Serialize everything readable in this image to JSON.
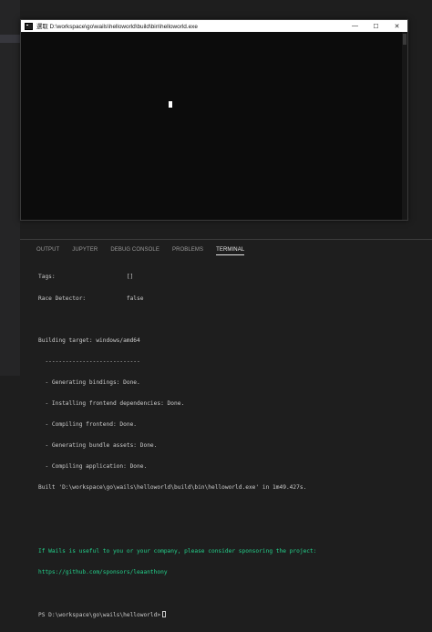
{
  "console": {
    "title": "選取 D:\\workspace\\go\\wails\\helloworld\\build\\bin\\helloworld.exe",
    "controls": {
      "minimize": "—",
      "maximize": "☐",
      "close": "✕"
    }
  },
  "panel": {
    "tabs": [
      {
        "label": "OUTPUT"
      },
      {
        "label": "JUPYTER"
      },
      {
        "label": "DEBUG CONSOLE"
      },
      {
        "label": "PROBLEMS"
      },
      {
        "label": "TERMINAL"
      }
    ],
    "active_tab": "TERMINAL"
  },
  "terminal": {
    "lines": [
      "Tags:                     []",
      "Race Detector:            false",
      "",
      "Building target: windows/amd64",
      "  ----------------------------",
      "  - Generating bindings: Done.",
      "  - Installing frontend dependencies: Done.",
      "  - Compiling frontend: Done.",
      "  - Generating bundle assets: Done.",
      "  - Compiling application: Done.",
      "Built 'D:\\workspace\\go\\wails\\helloworld\\build\\bin\\helloworld.exe' in 1m49.427s.",
      "",
      "",
      "If Wails is useful to you or your company, please consider sponsoring the project:",
      "https://github.com/sponsors/leaanthony",
      ""
    ],
    "prompt": "PS D:\\workspace\\go\\wails\\helloworld>",
    "colors": {
      "sponsor": "#23d18b",
      "text": "#cccccc"
    }
  }
}
